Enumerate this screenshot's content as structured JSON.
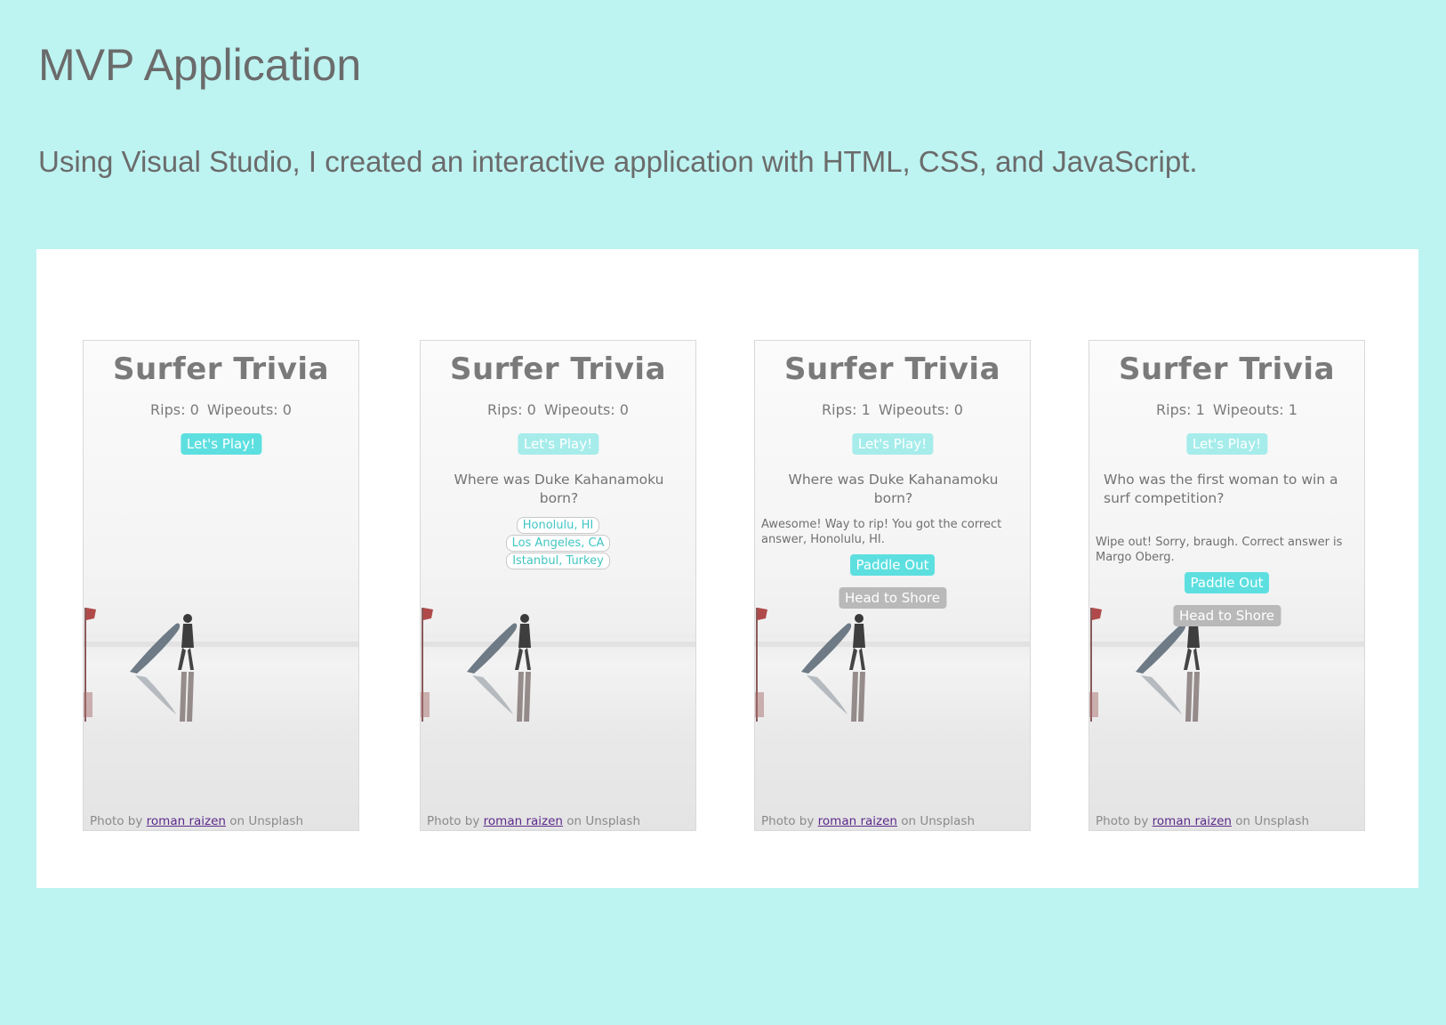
{
  "page": {
    "title": "MVP Application",
    "description": "Using Visual Studio, I created an interactive application with HTML, CSS, and JavaScript."
  },
  "screens": [
    {
      "app_title": "Surfer Trivia",
      "rips": "Rips: 0",
      "wipeouts": "Wipeouts: 0",
      "play_label": "Let's Play!",
      "credit": {
        "prefix": "Photo by",
        "author": "roman raizen",
        "suffix": "on Unsplash"
      }
    },
    {
      "app_title": "Surfer Trivia",
      "rips": "Rips: 0",
      "wipeouts": "Wipeouts: 0",
      "play_label": "Let's Play!",
      "question": "Where was Duke Kahanamoku born?",
      "answers": [
        "Honolulu, HI",
        "Los Angeles, CA",
        "Istanbul, Turkey"
      ],
      "credit": {
        "prefix": "Photo by",
        "author": "roman raizen",
        "suffix": "on Unsplash"
      }
    },
    {
      "app_title": "Surfer Trivia",
      "rips": "Rips: 1",
      "wipeouts": "Wipeouts: 0",
      "play_label": "Let's Play!",
      "question": "Where was Duke Kahanamoku born?",
      "feedback": "Awesome! Way to rip! You got the correct answer, Honolulu, HI.",
      "paddle_label": "Paddle Out",
      "shore_label": "Head to Shore",
      "credit": {
        "prefix": "Photo by",
        "author": "roman raizen",
        "suffix": "on Unsplash"
      }
    },
    {
      "app_title": "Surfer Trivia",
      "rips": "Rips: 1",
      "wipeouts": "Wipeouts: 1",
      "play_label": "Let's Play!",
      "question": "Who was the first woman to win a surf competition?",
      "feedback": "Wipe out! Sorry, braugh. Correct answer is Margo Oberg.",
      "paddle_label": "Paddle Out",
      "shore_label": "Head to Shore",
      "credit": {
        "prefix": "Photo by",
        "author": "roman raizen",
        "suffix": "on Unsplash"
      }
    }
  ],
  "colors": {
    "page_background": "#bdf3f1",
    "accent": "#5ddfe0",
    "secondary_button": "#b9b9b9",
    "link": "#5b2a8a"
  }
}
